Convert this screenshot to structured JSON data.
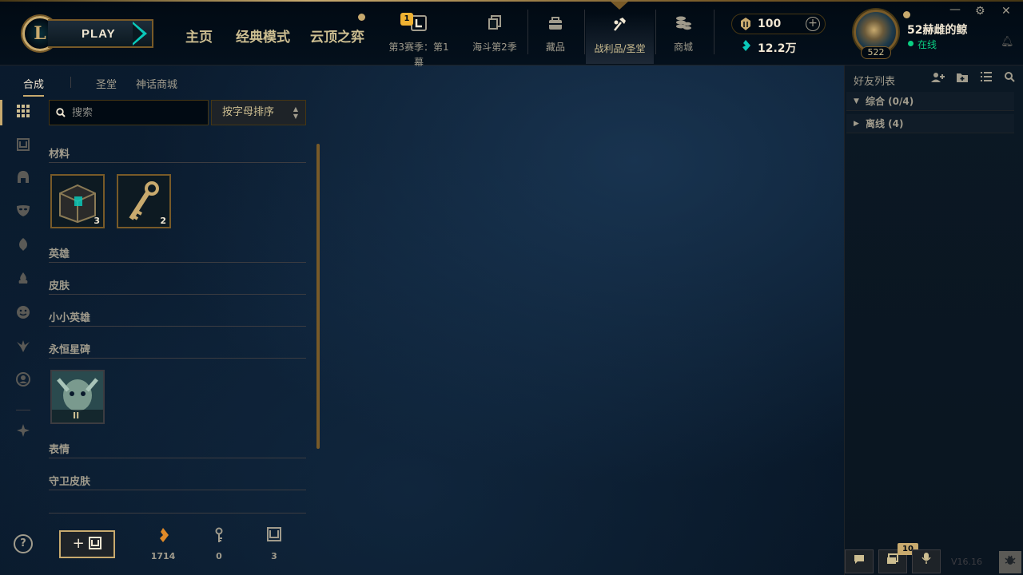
{
  "app": {
    "logo": "L",
    "play_label": "PLAY"
  },
  "main_nav": [
    {
      "label": "主页"
    },
    {
      "label": "经典模式"
    },
    {
      "label": "云顶之弈",
      "has_dot": true
    }
  ],
  "sub_nav": [
    {
      "label": "第3赛季：第1幕",
      "icon": "season-pass-icon",
      "badge": "1"
    },
    {
      "label": "海斗第2季",
      "icon": "event-cards-icon"
    },
    {
      "label": "藏品",
      "icon": "collection-bag-icon"
    },
    {
      "label": "战利品/圣堂",
      "icon": "loot-crafting-icon",
      "active": true
    },
    {
      "label": "商城",
      "icon": "store-coins-icon"
    }
  ],
  "currency": {
    "rp": "100",
    "blue_essence": "12.2万"
  },
  "profile": {
    "name": "52赫雌的鲸",
    "level": "522",
    "status": "在线"
  },
  "loot_tabs": [
    {
      "label": "合成",
      "active": true
    },
    {
      "label": "圣堂"
    },
    {
      "label": "神话商城"
    }
  ],
  "search": {
    "placeholder": "搜索"
  },
  "sort": {
    "selected": "按字母排序"
  },
  "categories": {
    "materials": "材料",
    "champions": "英雄",
    "skins": "皮肤",
    "little_legends": "小小英雄",
    "eternals": "永恒星碑",
    "emotes": "表情",
    "ward_skins": "守卫皮肤"
  },
  "materials": [
    {
      "name": "hextech-chest",
      "count": "3"
    },
    {
      "name": "key",
      "count": "2"
    }
  ],
  "eternals": [
    {
      "name": "eternal-series",
      "label": "II"
    }
  ],
  "resources": {
    "orange_essence": "1714",
    "key_fragments": "0",
    "chests": "3"
  },
  "friends": {
    "title": "好友列表",
    "groups": [
      {
        "label": "综合 (0/4)",
        "expanded": true
      },
      {
        "label": "离线 (4)",
        "expanded": false
      }
    ]
  },
  "footer": {
    "badge": "10",
    "version": "V16.16"
  },
  "colors": {
    "gold": "#c8aa6e",
    "gold_dark": "#785a28",
    "online_green": "#0acf83",
    "teal": "#0ac8b9"
  }
}
